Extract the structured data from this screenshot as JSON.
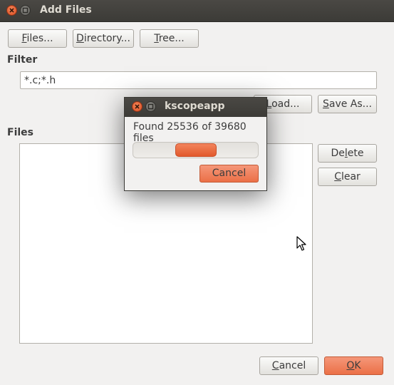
{
  "window": {
    "title": "Add Files"
  },
  "buttons": {
    "files": {
      "pre": "",
      "mn": "F",
      "post": "iles..."
    },
    "directory": {
      "pre": "",
      "mn": "D",
      "post": "irectory..."
    },
    "tree": {
      "pre": "",
      "mn": "T",
      "post": "ree..."
    },
    "load": {
      "pre": "",
      "mn": "L",
      "post": "oad..."
    },
    "save_as": {
      "pre": "",
      "mn": "S",
      "post": "ave As..."
    },
    "delete": {
      "pre": "De",
      "mn": "l",
      "post": "ete"
    },
    "clear": {
      "pre": "",
      "mn": "C",
      "post": "lear"
    },
    "cancel": {
      "pre": "",
      "mn": "C",
      "post": "ancel"
    },
    "ok": {
      "pre": "",
      "mn": "O",
      "post": "K"
    }
  },
  "filter": {
    "label": "Filter",
    "value": "*.c;*.h"
  },
  "files": {
    "label": "Files",
    "items": []
  },
  "progress_dialog": {
    "title": "kscopeapp",
    "message": "Found 25536 of 39680 files",
    "progress_fraction": 0.64,
    "indicator_position": 0.5,
    "cancel_label": "Cancel"
  },
  "colors": {
    "accent": "#eb7047",
    "titlebar": "#3c3b37",
    "window_bg": "#f2f1f0"
  },
  "icons": {
    "close": "close-icon",
    "minimize": "minimize-icon",
    "cursor": "mouse-pointer-icon"
  }
}
